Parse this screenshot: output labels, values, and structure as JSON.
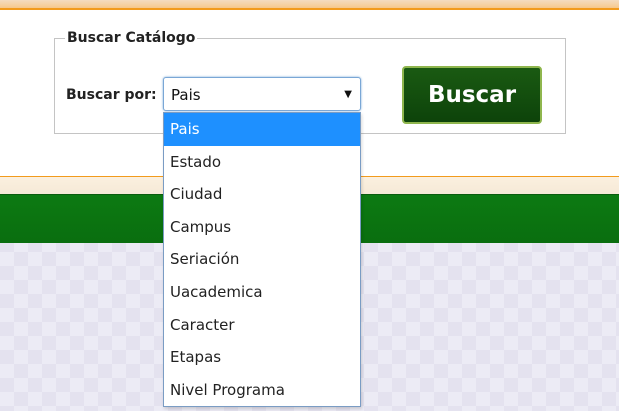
{
  "search": {
    "legend": "Buscar Catálogo",
    "label": "Buscar por:",
    "selected": "Pais",
    "arrow": "▼",
    "button_label": "Buscar"
  },
  "dropdown": {
    "options": [
      "Pais",
      "Estado",
      "Ciudad",
      "Campus",
      "Seriación",
      "Uacademica",
      "Caracter",
      "Etapas",
      "Nivel Programa"
    ],
    "highlighted_index": 0
  },
  "colors": {
    "accent_orange": "#f29b1d",
    "green_bar": "#0c7a12",
    "button_green": "#0d430a",
    "selection_blue": "#1e90ff"
  }
}
